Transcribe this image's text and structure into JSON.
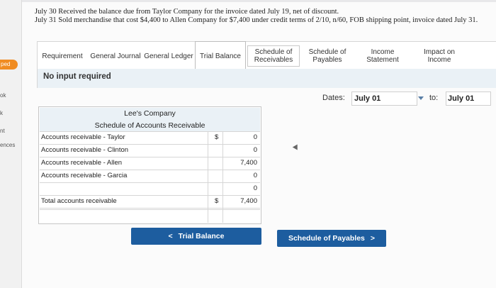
{
  "problem": {
    "line1": "July 30 Received the balance due from Taylor Company for the invoice dated July 19, net of discount.",
    "line2": "July 31 Sold merchandise that cost $4,400 to Allen Company for $7,400 under credit terms of 2/10, n/60, FOB shipping point, invoice dated July 31."
  },
  "sidebar": {
    "badge": "ped",
    "items": [
      "ok",
      "k",
      "nt",
      "ences"
    ]
  },
  "tabs": [
    {
      "label": "Requirement"
    },
    {
      "label": "General Journal"
    },
    {
      "label": "General Ledger"
    },
    {
      "label": "Trial Balance"
    },
    {
      "label": "Schedule of Receivables"
    },
    {
      "label": "Schedule of Payables"
    },
    {
      "label": "Income Statement"
    },
    {
      "label": "Impact on Income"
    }
  ],
  "notice": "No input required",
  "dates": {
    "label": "Dates:",
    "from": "July 01",
    "to_label": "to:",
    "to": "July 01"
  },
  "schedule": {
    "company": "Lee's Company",
    "title": "Schedule of Accounts Receivable",
    "rows": [
      {
        "label": "Accounts receivable - Taylor",
        "dollar": "$",
        "value": "0"
      },
      {
        "label": "Accounts receivable - Clinton",
        "dollar": "",
        "value": "0"
      },
      {
        "label": "Accounts receivable - Allen",
        "dollar": "",
        "value": "7,400"
      },
      {
        "label": "Accounts receivable - Garcia",
        "dollar": "",
        "value": "0"
      },
      {
        "label": "",
        "dollar": "",
        "value": "0"
      }
    ],
    "total": {
      "label": "Total accounts receivable",
      "dollar": "$",
      "value": "7,400"
    }
  },
  "nav": {
    "prev_label": "Trial Balance",
    "next_label": "Schedule of Payables",
    "prev_arrow": "<",
    "next_arrow": ">"
  },
  "colors": {
    "accent": "#1d5d9f",
    "badge": "#f08c22",
    "band": "#eaf1f6"
  }
}
